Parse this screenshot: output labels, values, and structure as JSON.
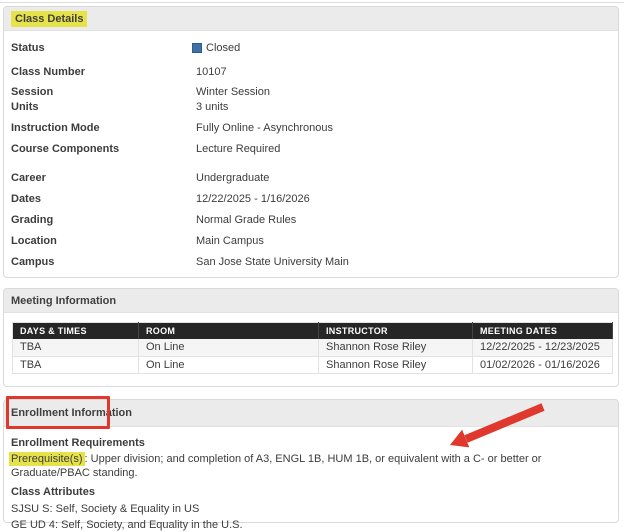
{
  "colors": {
    "status_closed_square": "#3d6fa8",
    "highlight_yellow": "#e6e24a",
    "annotation_red": "#df382c",
    "table_header_bg": "#262626"
  },
  "class_details": {
    "title": "Class Details",
    "fields": [
      {
        "label": "Status",
        "value": "Closed"
      },
      {
        "label": "Class Number",
        "value": "10107"
      },
      {
        "label": "Session",
        "value": "Winter Session"
      },
      {
        "label": "Units",
        "value": "3 units"
      },
      {
        "label": "Instruction Mode",
        "value": "Fully Online - Asynchronous"
      },
      {
        "label": "Course Components",
        "value": "Lecture Required"
      },
      {
        "label": "Career",
        "value": "Undergraduate"
      },
      {
        "label": "Dates",
        "value": "12/22/2025 - 1/16/2026"
      },
      {
        "label": "Grading",
        "value": "Normal Grade Rules"
      },
      {
        "label": "Location",
        "value": "Main Campus"
      },
      {
        "label": "Campus",
        "value": "San Jose State University Main"
      }
    ]
  },
  "meeting": {
    "title": "Meeting Information",
    "columns": [
      "DAYS & TIMES",
      "ROOM",
      "INSTRUCTOR",
      "MEETING DATES"
    ],
    "rows": [
      [
        "TBA",
        "On Line",
        "Shannon Rose Riley",
        "12/22/2025 - 12/23/2025"
      ],
      [
        "TBA",
        "On Line",
        "Shannon Rose Riley",
        "01/02/2026 - 01/16/2026"
      ]
    ]
  },
  "enrollment": {
    "title": "Enrollment Information",
    "requirements_heading": "Enrollment Requirements",
    "prerequisite_label": "Prerequisite(s)",
    "prerequisite_text": ": Upper division; and completion of A3, ENGL 1B, HUM 1B, or equivalent with a C- or better or Graduate/PBAC standing.",
    "attributes_heading": "Class Attributes",
    "attributes": [
      "SJSU S: Self, Society & Equality in US",
      "GE UD 4: Self, Society, and Equality in the U.S."
    ]
  }
}
